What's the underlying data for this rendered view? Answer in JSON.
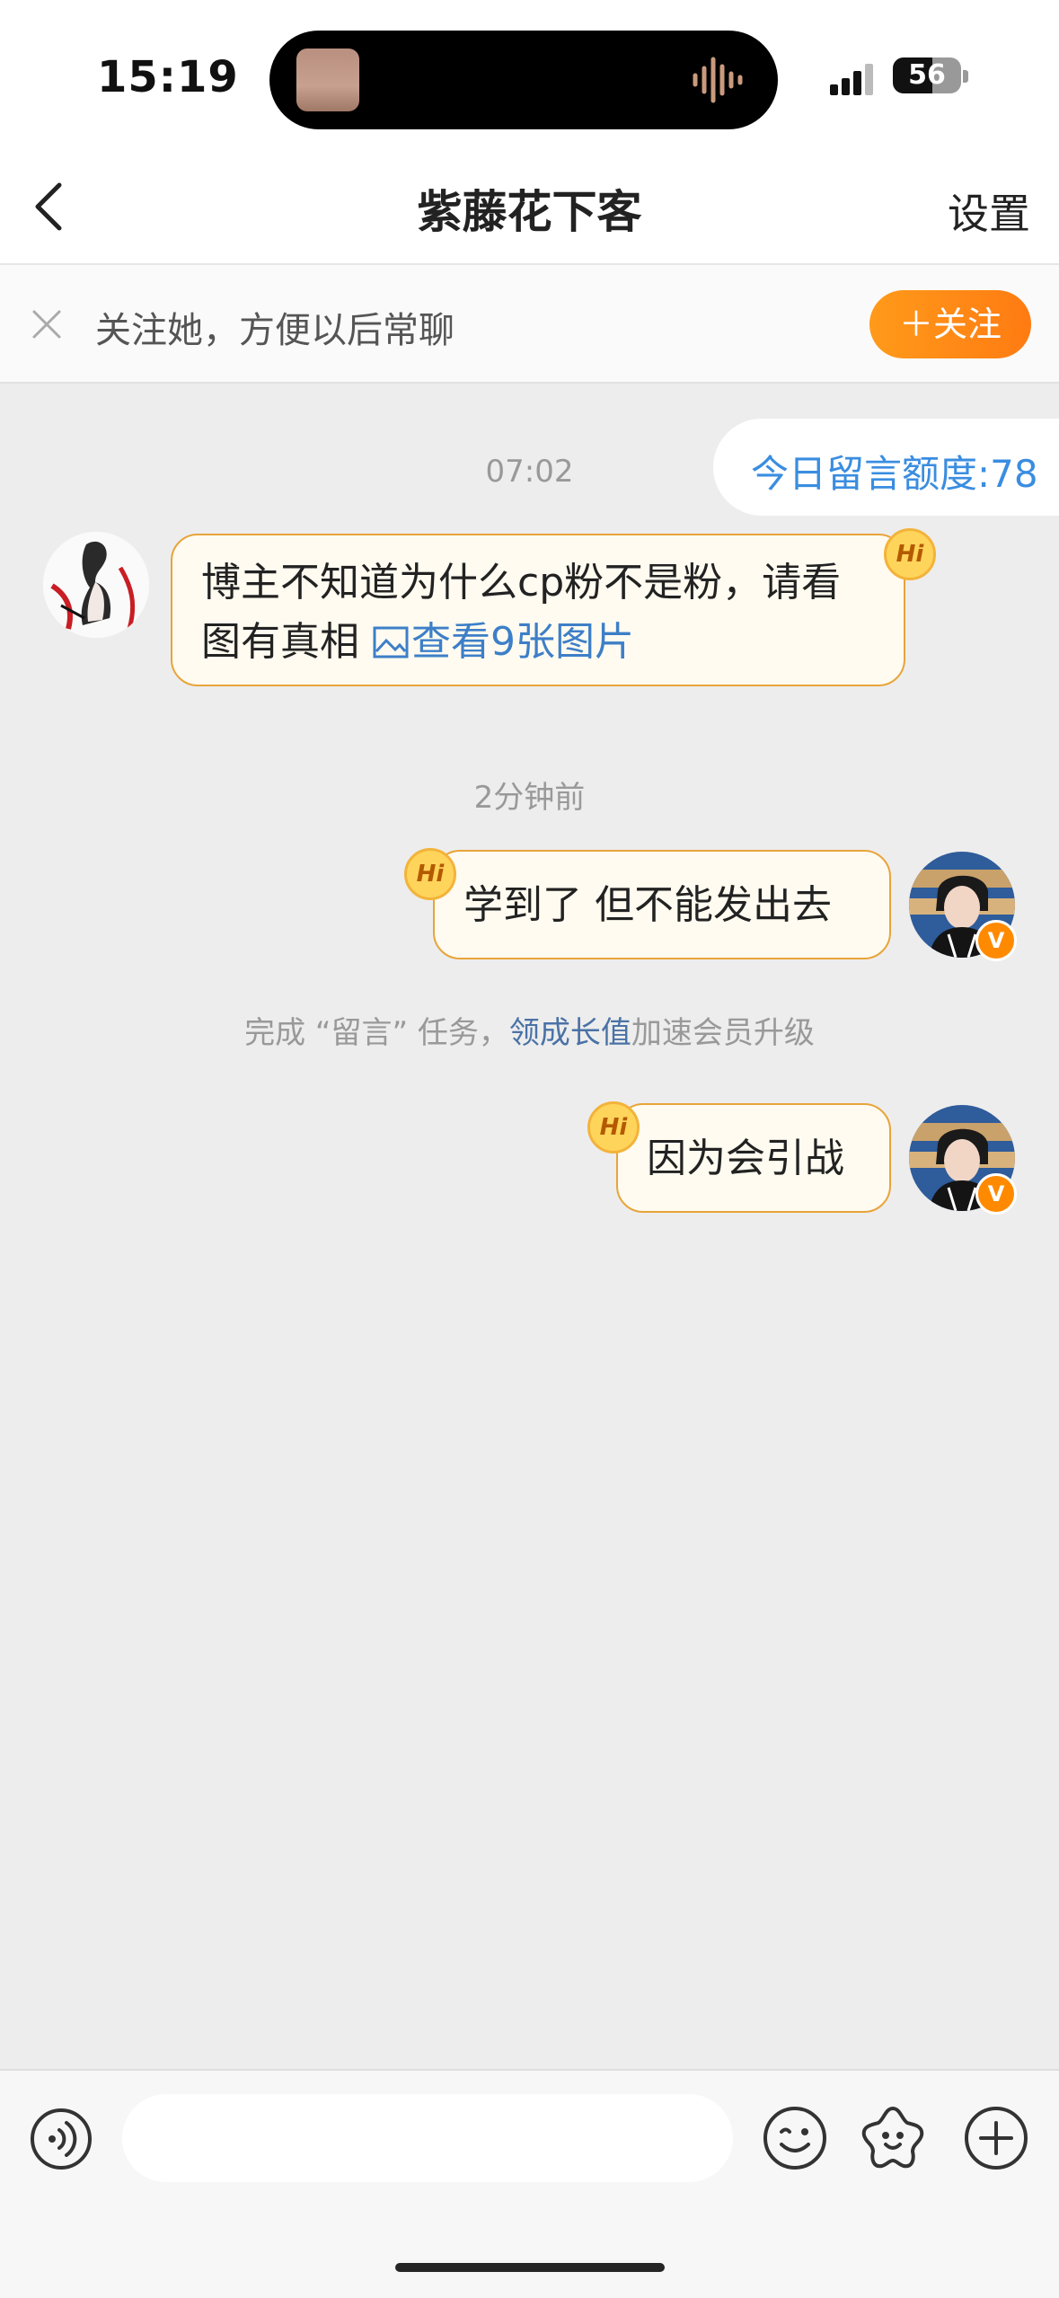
{
  "status_bar": {
    "time": "15:19",
    "battery": "56"
  },
  "header": {
    "title": "紫藤花下客",
    "settings_label": "设置"
  },
  "follow_banner": {
    "text": "关注她，方便以后常聊",
    "button_label": "＋关注"
  },
  "quota": {
    "text": "今日留言额度:78"
  },
  "messages": {
    "time1": "07:02",
    "incoming": {
      "hi_label": "Hi",
      "text": "博主不知道为什么cp粉不是粉，请看图有真相",
      "link_icon": "image-icon",
      "link_text": "查看9张图片"
    },
    "time2": "2分钟前",
    "outgoing1": {
      "hi_label": "Hi",
      "text": "学到了 但不能发出去",
      "badge": "V"
    },
    "task": {
      "prefix": "完成 “留言” 任务，",
      "link": "领成长值",
      "suffix": "加速会员升级"
    },
    "outgoing2": {
      "hi_label": "Hi",
      "text": "因为会引战",
      "badge": "V"
    }
  },
  "input_bar": {
    "placeholder": "",
    "icons": [
      "voice-icon",
      "emoji-icon",
      "sticker-icon",
      "plus-icon"
    ]
  },
  "colors": {
    "accent_orange": "#ff8a1a",
    "link_blue": "#3a8de0",
    "bubble_border": "#e8a43a",
    "bubble_bg": "#fffbf0",
    "chat_bg": "#ededed"
  }
}
